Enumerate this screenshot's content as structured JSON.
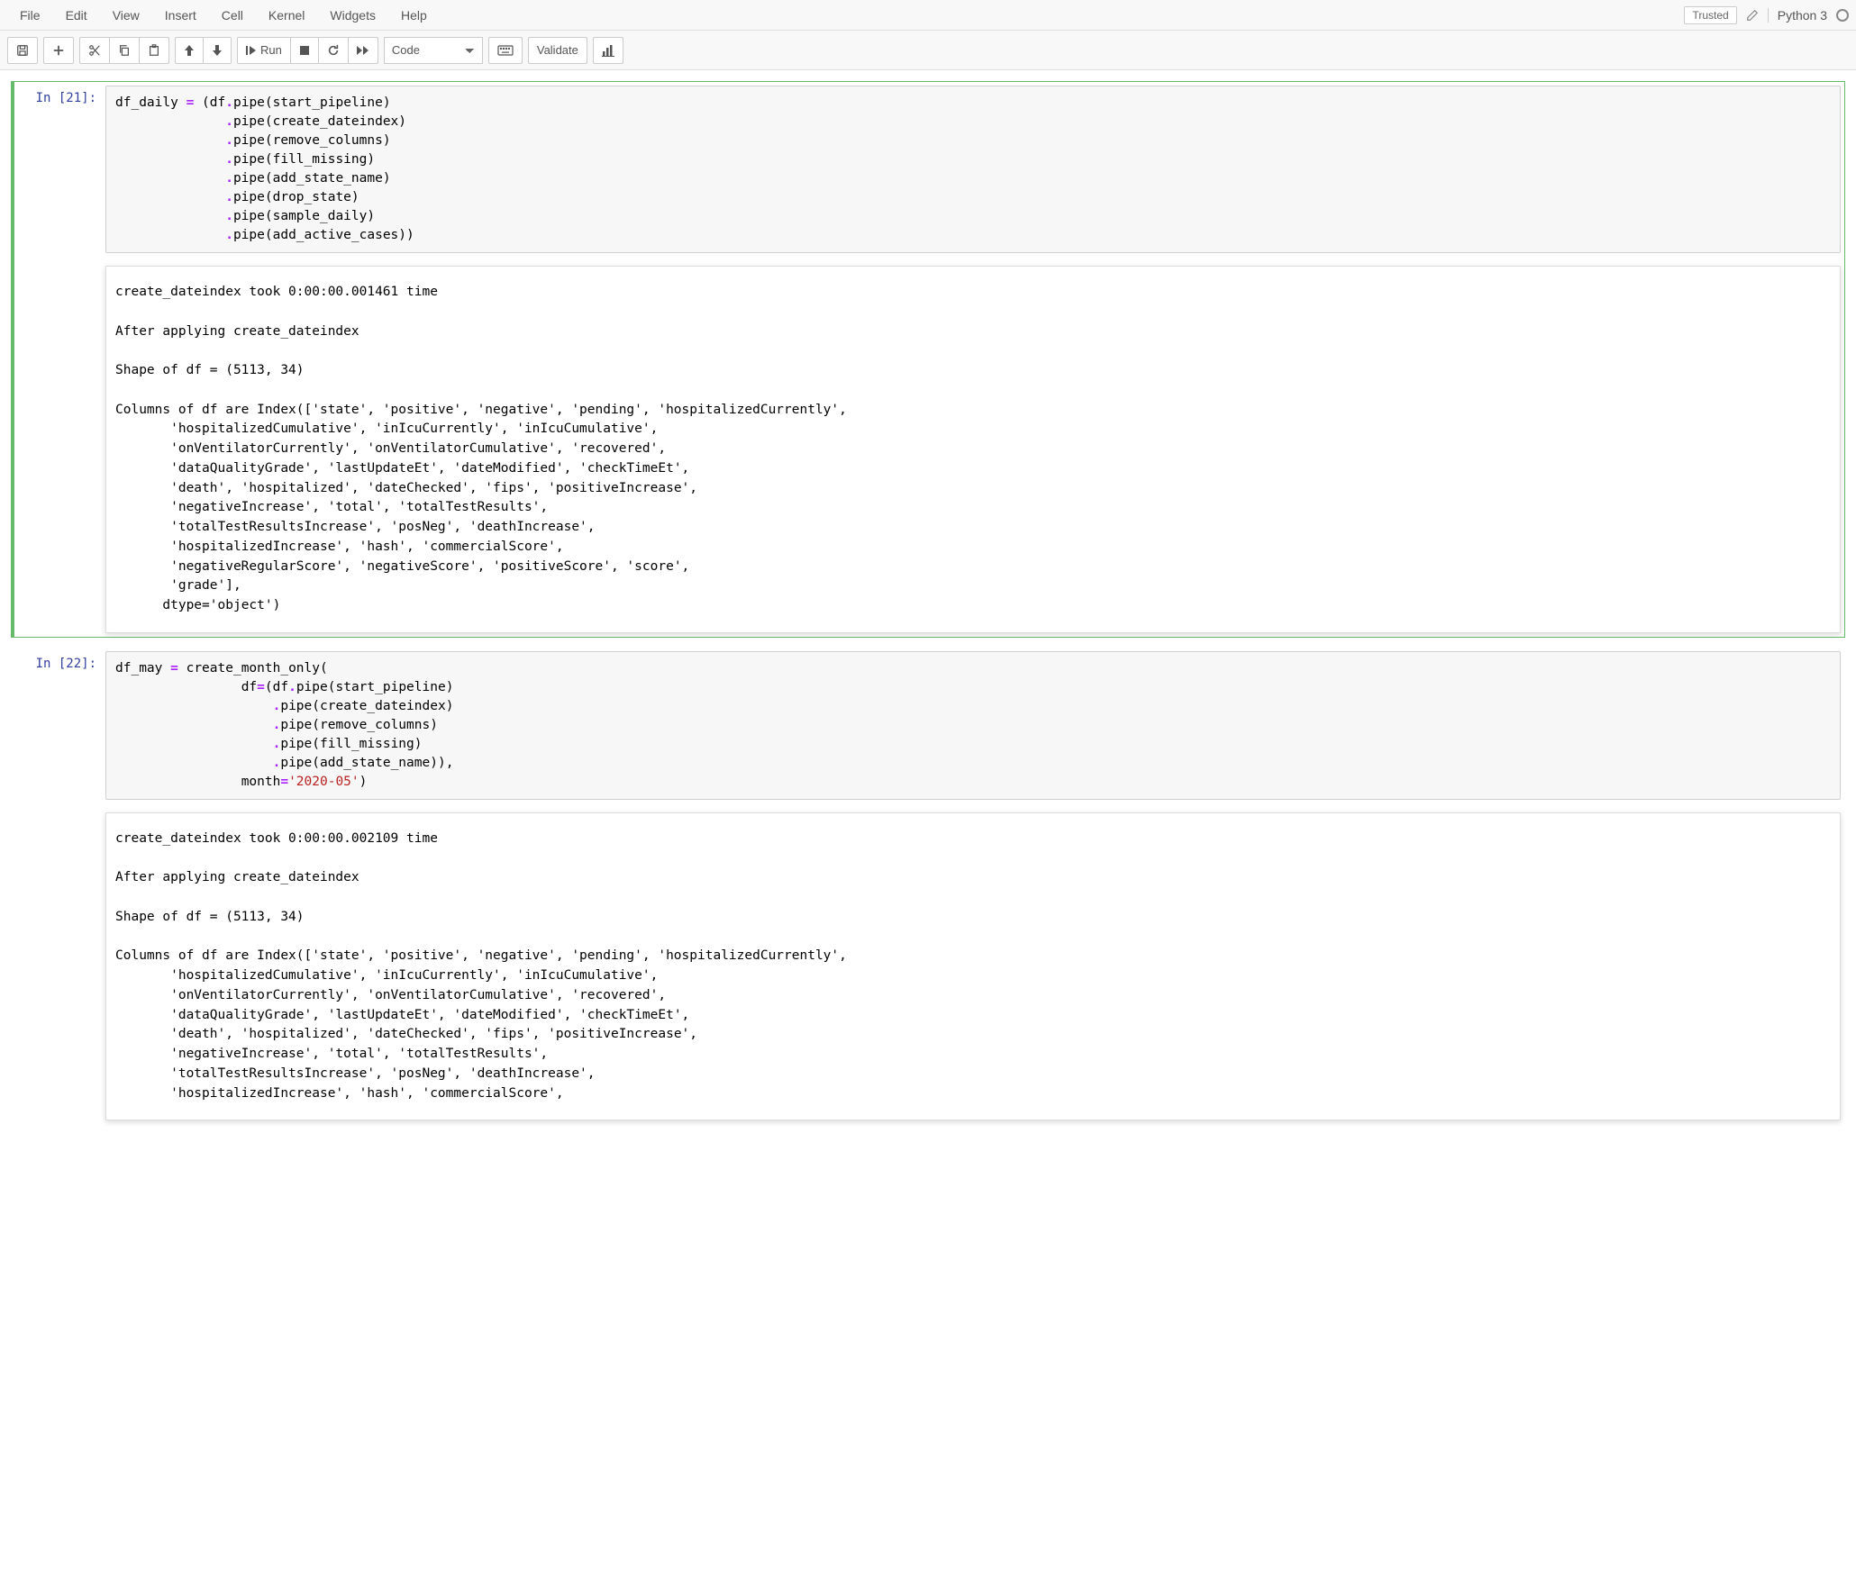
{
  "menubar": {
    "items": [
      "File",
      "Edit",
      "View",
      "Insert",
      "Cell",
      "Kernel",
      "Widgets",
      "Help"
    ],
    "trusted": "Trusted",
    "kernel": "Python 3"
  },
  "toolbar": {
    "run_label": "Run",
    "celltype_selected": "Code",
    "validate_label": "Validate"
  },
  "cells": [
    {
      "prompt": "In [21]:",
      "code_lines": [
        [
          [
            "var",
            "df_daily"
          ],
          [
            "pn",
            " "
          ],
          [
            "op",
            "="
          ],
          [
            "pn",
            " "
          ],
          [
            "pn",
            "("
          ],
          [
            "var",
            "df"
          ],
          [
            "op",
            "."
          ],
          [
            "fn",
            "pipe"
          ],
          [
            "pn",
            "("
          ],
          [
            "var",
            "start_pipeline"
          ],
          [
            "pn",
            ")"
          ]
        ],
        [
          [
            "pn",
            "              "
          ],
          [
            "op",
            "."
          ],
          [
            "fn",
            "pipe"
          ],
          [
            "pn",
            "("
          ],
          [
            "var",
            "create_dateindex"
          ],
          [
            "pn",
            ")"
          ]
        ],
        [
          [
            "pn",
            "              "
          ],
          [
            "op",
            "."
          ],
          [
            "fn",
            "pipe"
          ],
          [
            "pn",
            "("
          ],
          [
            "var",
            "remove_columns"
          ],
          [
            "pn",
            ")"
          ]
        ],
        [
          [
            "pn",
            "              "
          ],
          [
            "op",
            "."
          ],
          [
            "fn",
            "pipe"
          ],
          [
            "pn",
            "("
          ],
          [
            "var",
            "fill_missing"
          ],
          [
            "pn",
            ")"
          ]
        ],
        [
          [
            "pn",
            "              "
          ],
          [
            "op",
            "."
          ],
          [
            "fn",
            "pipe"
          ],
          [
            "pn",
            "("
          ],
          [
            "var",
            "add_state_name"
          ],
          [
            "pn",
            ")"
          ]
        ],
        [
          [
            "pn",
            "              "
          ],
          [
            "op",
            "."
          ],
          [
            "fn",
            "pipe"
          ],
          [
            "pn",
            "("
          ],
          [
            "var",
            "drop_state"
          ],
          [
            "pn",
            ")"
          ]
        ],
        [
          [
            "pn",
            "              "
          ],
          [
            "op",
            "."
          ],
          [
            "fn",
            "pipe"
          ],
          [
            "pn",
            "("
          ],
          [
            "var",
            "sample_daily"
          ],
          [
            "pn",
            ")"
          ]
        ],
        [
          [
            "pn",
            "              "
          ],
          [
            "op",
            "."
          ],
          [
            "fn",
            "pipe"
          ],
          [
            "pn",
            "("
          ],
          [
            "var",
            "add_active_cases"
          ],
          [
            "pn",
            ")"
          ],
          [
            "pn",
            ")"
          ]
        ]
      ],
      "output": "create_dateindex took 0:00:00.001461 time\n\nAfter applying create_dateindex\n\nShape of df = (5113, 34)\n\nColumns of df are Index(['state', 'positive', 'negative', 'pending', 'hospitalizedCurrently',\n       'hospitalizedCumulative', 'inIcuCurrently', 'inIcuCumulative',\n       'onVentilatorCurrently', 'onVentilatorCumulative', 'recovered',\n       'dataQualityGrade', 'lastUpdateEt', 'dateModified', 'checkTimeEt',\n       'death', 'hospitalized', 'dateChecked', 'fips', 'positiveIncrease',\n       'negativeIncrease', 'total', 'totalTestResults',\n       'totalTestResultsIncrease', 'posNeg', 'deathIncrease',\n       'hospitalizedIncrease', 'hash', 'commercialScore',\n       'negativeRegularScore', 'negativeScore', 'positiveScore', 'score',\n       'grade'],\n      dtype='object')"
    },
    {
      "prompt": "In [22]:",
      "code_lines": [
        [
          [
            "var",
            "df_may"
          ],
          [
            "pn",
            " "
          ],
          [
            "op",
            "="
          ],
          [
            "pn",
            " "
          ],
          [
            "fn",
            "create_month_only"
          ],
          [
            "pn",
            "("
          ]
        ],
        [
          [
            "pn",
            "                "
          ],
          [
            "var",
            "df"
          ],
          [
            "op",
            "="
          ],
          [
            "pn",
            "("
          ],
          [
            "var",
            "df"
          ],
          [
            "op",
            "."
          ],
          [
            "fn",
            "pipe"
          ],
          [
            "pn",
            "("
          ],
          [
            "var",
            "start_pipeline"
          ],
          [
            "pn",
            ")"
          ]
        ],
        [
          [
            "pn",
            "                    "
          ],
          [
            "op",
            "."
          ],
          [
            "fn",
            "pipe"
          ],
          [
            "pn",
            "("
          ],
          [
            "var",
            "create_dateindex"
          ],
          [
            "pn",
            ")"
          ]
        ],
        [
          [
            "pn",
            "                    "
          ],
          [
            "op",
            "."
          ],
          [
            "fn",
            "pipe"
          ],
          [
            "pn",
            "("
          ],
          [
            "var",
            "remove_columns"
          ],
          [
            "pn",
            ")"
          ]
        ],
        [
          [
            "pn",
            "                    "
          ],
          [
            "op",
            "."
          ],
          [
            "fn",
            "pipe"
          ],
          [
            "pn",
            "("
          ],
          [
            "var",
            "fill_missing"
          ],
          [
            "pn",
            ")"
          ]
        ],
        [
          [
            "pn",
            "                    "
          ],
          [
            "op",
            "."
          ],
          [
            "fn",
            "pipe"
          ],
          [
            "pn",
            "("
          ],
          [
            "var",
            "add_state_name"
          ],
          [
            "pn",
            ")"
          ],
          [
            "pn",
            ")"
          ],
          [
            "pn",
            ","
          ]
        ],
        [
          [
            "pn",
            "                "
          ],
          [
            "var",
            "month"
          ],
          [
            "op",
            "="
          ],
          [
            "str",
            "'2020-05'"
          ],
          [
            "pn",
            ")"
          ]
        ]
      ],
      "output": "create_dateindex took 0:00:00.002109 time\n\nAfter applying create_dateindex\n\nShape of df = (5113, 34)\n\nColumns of df are Index(['state', 'positive', 'negative', 'pending', 'hospitalizedCurrently',\n       'hospitalizedCumulative', 'inIcuCurrently', 'inIcuCumulative',\n       'onVentilatorCurrently', 'onVentilatorCumulative', 'recovered',\n       'dataQualityGrade', 'lastUpdateEt', 'dateModified', 'checkTimeEt',\n       'death', 'hospitalized', 'dateChecked', 'fips', 'positiveIncrease',\n       'negativeIncrease', 'total', 'totalTestResults',\n       'totalTestResultsIncrease', 'posNeg', 'deathIncrease',\n       'hospitalizedIncrease', 'hash', 'commercialScore',"
    }
  ]
}
